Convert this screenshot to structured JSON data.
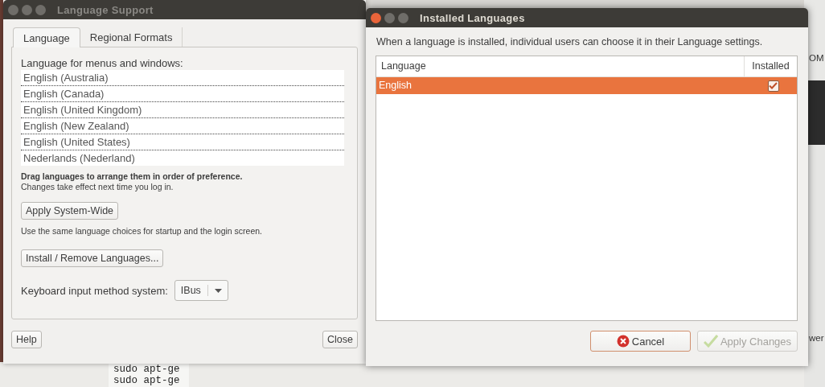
{
  "desktop": {
    "terminal_lines": [
      "sudo apt-ge",
      "sudo apt-ge"
    ],
    "fragments": [
      {
        "kind": "top",
        "text": "OM"
      },
      {
        "kind": "bottom",
        "text": "wer"
      }
    ]
  },
  "language_support": {
    "title": "Language Support",
    "active": false,
    "tabs": [
      {
        "label": "Language",
        "selected": true
      },
      {
        "label": "Regional Formats",
        "selected": false
      }
    ],
    "list_label": "Language for menus and windows:",
    "languages": [
      "English (Australia)",
      "English (Canada)",
      "English (United Kingdom)",
      "English (New Zealand)",
      "English (United States)",
      "Nederlands (Nederland)"
    ],
    "drag_hint": "Drag languages to arrange them in order of preference.",
    "changes_hint": "Changes take effect next time you log in.",
    "apply_button": "Apply System-Wide",
    "apply_note": "Use the same language choices for startup and the login screen.",
    "install_button": "Install / Remove Languages...",
    "keyboard_label": "Keyboard input method system:",
    "keyboard_value": "IBus",
    "help_button": "Help",
    "close_button": "Close"
  },
  "installed_languages": {
    "title": "Installed Languages",
    "active": true,
    "description": "When a language is installed, individual users can choose it in their Language settings.",
    "columns": [
      "Language",
      "Installed"
    ],
    "rows": [
      {
        "language": "English",
        "installed": true,
        "selected": true
      }
    ],
    "cancel_button": "Cancel",
    "apply_button": {
      "label": "Apply Changes",
      "disabled": true
    }
  }
}
